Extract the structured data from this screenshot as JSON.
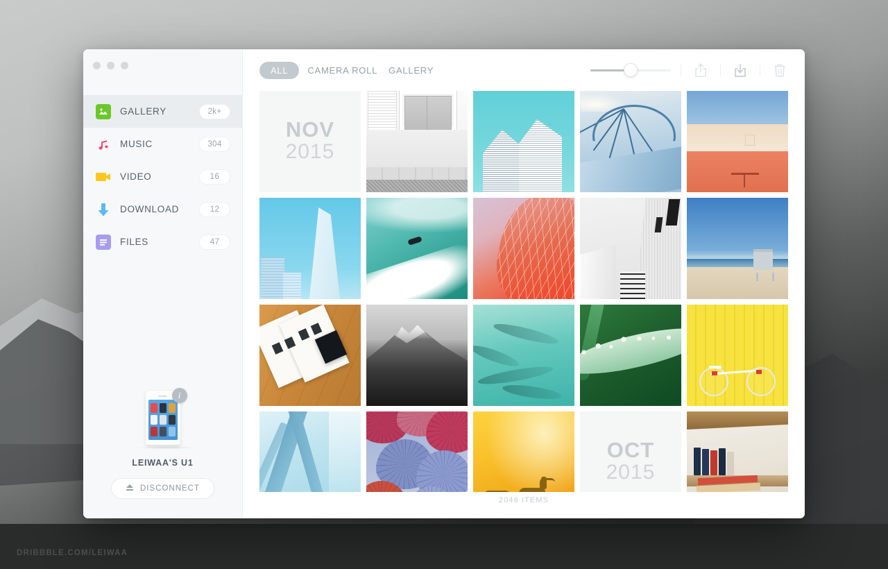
{
  "watermark": "DRIBBBLE.COM/LEIWAA",
  "window": {
    "traffic_lights": [
      "close",
      "minimize",
      "zoom"
    ]
  },
  "sidebar": {
    "items": [
      {
        "label": "GALLERY",
        "badge": "2k+",
        "icon": "image-icon",
        "color": "#6cc72a",
        "active": true
      },
      {
        "label": "MUSIC",
        "badge": "304",
        "icon": "music-note-icon",
        "color": "#f8476b",
        "active": false
      },
      {
        "label": "VIDEO",
        "badge": "16",
        "icon": "video-camera-icon",
        "color": "#ffc61e",
        "active": false
      },
      {
        "label": "DOWNLOAD",
        "badge": "12",
        "icon": "download-arrow-icon",
        "color": "#5cb8f0",
        "active": false
      },
      {
        "label": "FILES",
        "badge": "47",
        "icon": "files-icon",
        "color": "#a99cf0",
        "active": false
      }
    ],
    "device": {
      "name": "LEIWAA'S U1",
      "info_badge": "i",
      "disconnect_label": "DISCONNECT",
      "eject_icon": "eject-icon",
      "thumbnail_icon": "phone-icon"
    }
  },
  "toolbar": {
    "tabs": [
      {
        "label": "ALL",
        "active": true
      },
      {
        "label": "CAMERA ROLL",
        "active": false
      },
      {
        "label": "GALLERY",
        "active": false
      }
    ],
    "zoom_slider": {
      "value": 50,
      "min": 0,
      "max": 100,
      "name": "thumbnail-size-slider"
    },
    "actions": [
      {
        "icon": "share-icon",
        "label": "Share",
        "state": "normal"
      },
      {
        "icon": "download-icon",
        "label": "Download",
        "state": "active"
      },
      {
        "icon": "trash-icon",
        "label": "Delete",
        "state": "normal"
      }
    ]
  },
  "gallery": {
    "item_count_label": "2046 ITEMS",
    "tiles": [
      {
        "kind": "date",
        "month": "NOV",
        "year": "2015",
        "art": ""
      },
      {
        "kind": "photo",
        "caption": "white shuttered window on stone wall",
        "art": "p-window"
      },
      {
        "kind": "photo",
        "caption": "twin glass towers against teal sky",
        "art": "p-towers"
      },
      {
        "kind": "photo",
        "caption": "blue sailing rigging and mast",
        "art": "p-sails"
      },
      {
        "kind": "photo",
        "caption": "red and beige wall under blue sky",
        "art": "p-wall"
      },
      {
        "kind": "photo",
        "caption": "city skyscraper spire in blue sky",
        "art": "p-city"
      },
      {
        "kind": "photo",
        "caption": "surfer riding a turquoise wave",
        "art": "p-surf"
      },
      {
        "kind": "photo",
        "caption": "red lattice glass dome building",
        "art": "p-gherkin"
      },
      {
        "kind": "photo",
        "caption": "black and white concrete corridor",
        "art": "p-bw"
      },
      {
        "kind": "photo",
        "caption": "lifeguard tower on the beach",
        "art": "p-beach"
      },
      {
        "kind": "photo",
        "caption": "open book on wooden table",
        "art": "p-book"
      },
      {
        "kind": "photo",
        "caption": "black and white mountain ridge",
        "art": "p-mtn"
      },
      {
        "kind": "photo",
        "caption": "fish swimming in turquoise water",
        "art": "p-fish"
      },
      {
        "kind": "photo",
        "caption": "dew drops on a green leaf",
        "art": "p-leaf"
      },
      {
        "kind": "photo",
        "caption": "bicycle against a yellow wall",
        "art": "p-bike"
      },
      {
        "kind": "photo",
        "caption": "pale blue glass architecture",
        "art": "p-glass"
      },
      {
        "kind": "photo",
        "caption": "pink and blue parasols overhead",
        "art": "p-umb"
      },
      {
        "kind": "photo",
        "caption": "deer silhouettes in golden mist",
        "art": "p-deer"
      },
      {
        "kind": "date",
        "month": "OCT",
        "year": "2015",
        "art": ""
      },
      {
        "kind": "photo",
        "caption": "books on a wooden shelf",
        "art": "p-shelf"
      }
    ]
  }
}
